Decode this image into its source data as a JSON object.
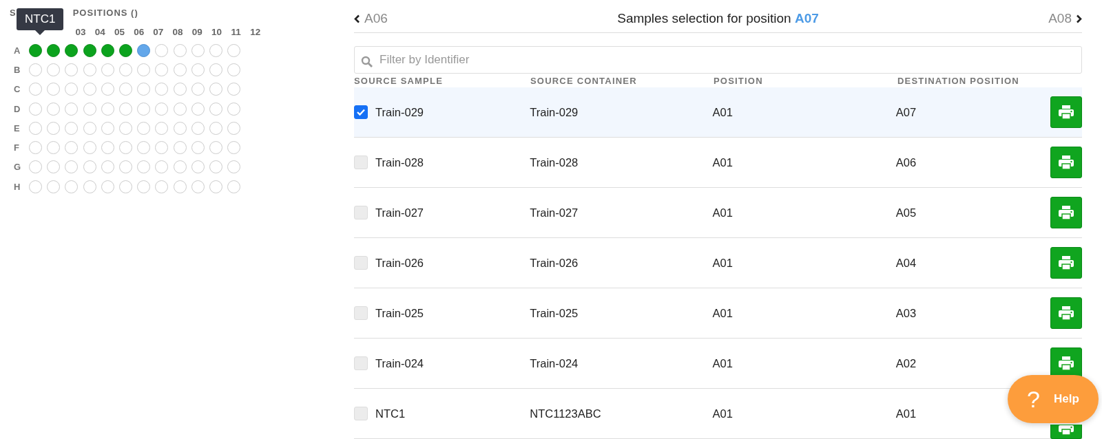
{
  "plate": {
    "title_start": "S",
    "title_end": "POSITIONS ()",
    "tooltip": "NTC1",
    "columns": [
      "03",
      "04",
      "05",
      "06",
      "07",
      "08",
      "09",
      "10",
      "11",
      "12"
    ],
    "rows": [
      {
        "label": "A",
        "wells": [
          {
            "filled": true,
            "selected": false
          },
          {
            "filled": true,
            "selected": false
          },
          {
            "filled": true,
            "selected": false
          },
          {
            "filled": true,
            "selected": false
          },
          {
            "filled": true,
            "selected": false
          },
          {
            "filled": true,
            "selected": false
          },
          {
            "filled": false,
            "selected": true
          },
          {
            "filled": false,
            "selected": false
          },
          {
            "filled": false,
            "selected": false
          },
          {
            "filled": false,
            "selected": false
          },
          {
            "filled": false,
            "selected": false
          },
          {
            "filled": false,
            "selected": false
          }
        ]
      },
      {
        "label": "B",
        "wells": [
          {
            "filled": false,
            "selected": false
          },
          {
            "filled": false,
            "selected": false
          },
          {
            "filled": false,
            "selected": false
          },
          {
            "filled": false,
            "selected": false
          },
          {
            "filled": false,
            "selected": false
          },
          {
            "filled": false,
            "selected": false
          },
          {
            "filled": false,
            "selected": false
          },
          {
            "filled": false,
            "selected": false
          },
          {
            "filled": false,
            "selected": false
          },
          {
            "filled": false,
            "selected": false
          },
          {
            "filled": false,
            "selected": false
          },
          {
            "filled": false,
            "selected": false
          }
        ]
      },
      {
        "label": "C",
        "wells": [
          {
            "filled": false,
            "selected": false
          },
          {
            "filled": false,
            "selected": false
          },
          {
            "filled": false,
            "selected": false
          },
          {
            "filled": false,
            "selected": false
          },
          {
            "filled": false,
            "selected": false
          },
          {
            "filled": false,
            "selected": false
          },
          {
            "filled": false,
            "selected": false
          },
          {
            "filled": false,
            "selected": false
          },
          {
            "filled": false,
            "selected": false
          },
          {
            "filled": false,
            "selected": false
          },
          {
            "filled": false,
            "selected": false
          },
          {
            "filled": false,
            "selected": false
          }
        ]
      },
      {
        "label": "D",
        "wells": [
          {
            "filled": false,
            "selected": false
          },
          {
            "filled": false,
            "selected": false
          },
          {
            "filled": false,
            "selected": false
          },
          {
            "filled": false,
            "selected": false
          },
          {
            "filled": false,
            "selected": false
          },
          {
            "filled": false,
            "selected": false
          },
          {
            "filled": false,
            "selected": false
          },
          {
            "filled": false,
            "selected": false
          },
          {
            "filled": false,
            "selected": false
          },
          {
            "filled": false,
            "selected": false
          },
          {
            "filled": false,
            "selected": false
          },
          {
            "filled": false,
            "selected": false
          }
        ]
      },
      {
        "label": "E",
        "wells": [
          {
            "filled": false,
            "selected": false
          },
          {
            "filled": false,
            "selected": false
          },
          {
            "filled": false,
            "selected": false
          },
          {
            "filled": false,
            "selected": false
          },
          {
            "filled": false,
            "selected": false
          },
          {
            "filled": false,
            "selected": false
          },
          {
            "filled": false,
            "selected": false
          },
          {
            "filled": false,
            "selected": false
          },
          {
            "filled": false,
            "selected": false
          },
          {
            "filled": false,
            "selected": false
          },
          {
            "filled": false,
            "selected": false
          },
          {
            "filled": false,
            "selected": false
          }
        ]
      },
      {
        "label": "F",
        "wells": [
          {
            "filled": false,
            "selected": false
          },
          {
            "filled": false,
            "selected": false
          },
          {
            "filled": false,
            "selected": false
          },
          {
            "filled": false,
            "selected": false
          },
          {
            "filled": false,
            "selected": false
          },
          {
            "filled": false,
            "selected": false
          },
          {
            "filled": false,
            "selected": false
          },
          {
            "filled": false,
            "selected": false
          },
          {
            "filled": false,
            "selected": false
          },
          {
            "filled": false,
            "selected": false
          },
          {
            "filled": false,
            "selected": false
          },
          {
            "filled": false,
            "selected": false
          }
        ]
      },
      {
        "label": "G",
        "wells": [
          {
            "filled": false,
            "selected": false
          },
          {
            "filled": false,
            "selected": false
          },
          {
            "filled": false,
            "selected": false
          },
          {
            "filled": false,
            "selected": false
          },
          {
            "filled": false,
            "selected": false
          },
          {
            "filled": false,
            "selected": false
          },
          {
            "filled": false,
            "selected": false
          },
          {
            "filled": false,
            "selected": false
          },
          {
            "filled": false,
            "selected": false
          },
          {
            "filled": false,
            "selected": false
          },
          {
            "filled": false,
            "selected": false
          },
          {
            "filled": false,
            "selected": false
          }
        ]
      },
      {
        "label": "H",
        "wells": [
          {
            "filled": false,
            "selected": false
          },
          {
            "filled": false,
            "selected": false
          },
          {
            "filled": false,
            "selected": false
          },
          {
            "filled": false,
            "selected": false
          },
          {
            "filled": false,
            "selected": false
          },
          {
            "filled": false,
            "selected": false
          },
          {
            "filled": false,
            "selected": false
          },
          {
            "filled": false,
            "selected": false
          },
          {
            "filled": false,
            "selected": false
          },
          {
            "filled": false,
            "selected": false
          },
          {
            "filled": false,
            "selected": false
          },
          {
            "filled": false,
            "selected": false
          }
        ]
      }
    ]
  },
  "nav": {
    "previous": "A06",
    "title": "Samples selection for position",
    "position": "A07",
    "next": "A08"
  },
  "search": {
    "placeholder": "Filter by Identifier"
  },
  "table": {
    "columns": [
      "SOURCE SAMPLE",
      "SOURCE CONTAINER",
      "POSITION",
      "DESTINATION POSITION"
    ],
    "rows": [
      {
        "sample": "Train-029",
        "container": "Train-029",
        "position": "A01",
        "destination": "A07",
        "selected": true
      },
      {
        "sample": "Train-028",
        "container": "Train-028",
        "position": "A01",
        "destination": "A06",
        "selected": false
      },
      {
        "sample": "Train-027",
        "container": "Train-027",
        "position": "A01",
        "destination": "A05",
        "selected": false
      },
      {
        "sample": "Train-026",
        "container": "Train-026",
        "position": "A01",
        "destination": "A04",
        "selected": false
      },
      {
        "sample": "Train-025",
        "container": "Train-025",
        "position": "A01",
        "destination": "A03",
        "selected": false
      },
      {
        "sample": "Train-024",
        "container": "Train-024",
        "position": "A01",
        "destination": "A02",
        "selected": false
      },
      {
        "sample": "NTC1",
        "container": "NTC1123ABC",
        "position": "A01",
        "destination": "A01",
        "selected": false
      }
    ]
  },
  "help": {
    "label": "Help",
    "icon": "?"
  }
}
